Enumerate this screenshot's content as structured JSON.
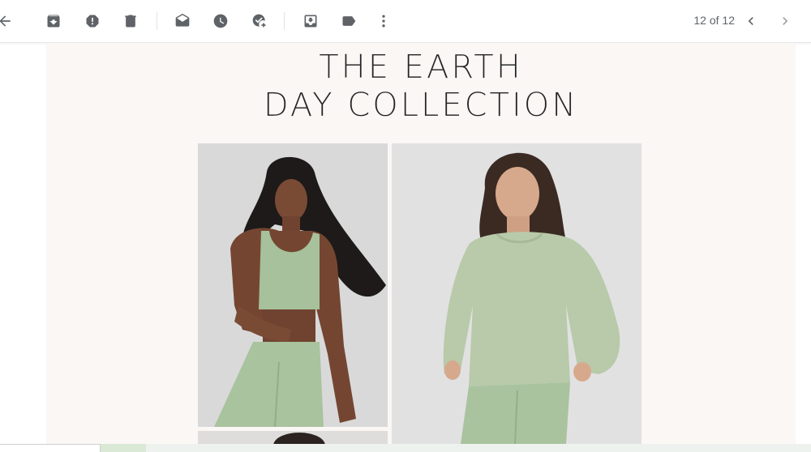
{
  "toolbar": {
    "icons": [
      "back-arrow-icon",
      "archive-icon",
      "report-spam-icon",
      "delete-icon",
      "mark-unread-icon",
      "snooze-icon",
      "add-to-tasks-icon",
      "move-to-icon",
      "label-icon",
      "more-icon",
      "chevron-left-icon",
      "chevron-right-icon"
    ],
    "pager_text": "12 of 12",
    "icon_color": "#5f6368"
  },
  "email": {
    "headline_line1": "THE EARTH",
    "headline_line2": "DAY COLLECTION",
    "background_color": "#faf7f5",
    "accent_green": "#a9c39e",
    "photos": [
      "model-in-green-sports-bra-photo",
      "model-in-green-sweatshirt-photo",
      "next-product-photo"
    ]
  }
}
